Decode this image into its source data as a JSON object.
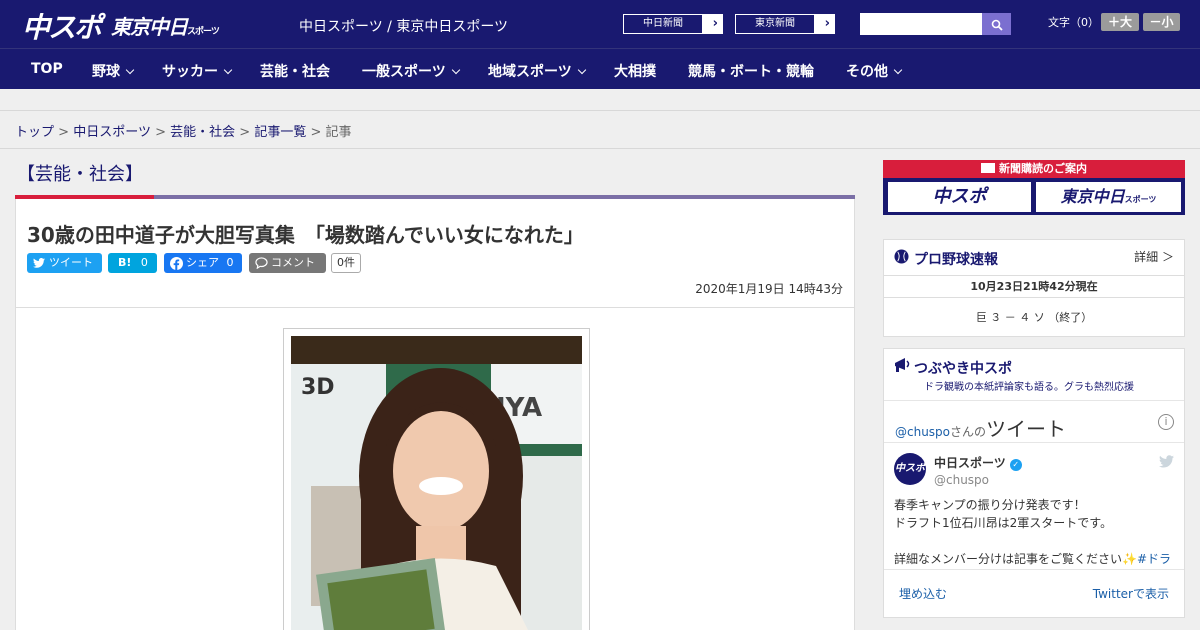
{
  "header": {
    "logo_main": "中スポ",
    "logo_tokyo": "東京中日",
    "logo_tokyo_small": "スポーツ",
    "site_title": "中日スポーツ / 東京中日スポーツ",
    "paper_links": [
      {
        "label": "中日新聞",
        "arrow": "›"
      },
      {
        "label": "東京新聞",
        "arrow": "›"
      }
    ],
    "search_placeholder": "",
    "fontsize_label": "文字（0）",
    "fontsize_up": "＋大",
    "fontsize_down": "－小"
  },
  "nav": {
    "items": [
      {
        "label": "TOP"
      },
      {
        "label": "野球"
      },
      {
        "label": "サッカー"
      },
      {
        "label": "芸能・社会"
      },
      {
        "label": "一般スポーツ"
      },
      {
        "label": "地域スポーツ"
      },
      {
        "label": "大相撲"
      },
      {
        "label": "競馬・ボート・競輪"
      },
      {
        "label": "その他"
      }
    ]
  },
  "breadcrumb": {
    "items": [
      "トップ",
      "中日スポーツ",
      "芸能・社会",
      "記事一覧"
    ],
    "separator": ">",
    "current": "記事"
  },
  "article": {
    "category": "【芸能・社会】",
    "headline": "30歳の田中道子が大胆写真集　「場数踏んでいい女になれた」",
    "share": {
      "tweet_label": "ツイート",
      "hatena_label": "B!",
      "hatena_count": "0",
      "facebook_label": "シェア",
      "facebook_count": "0",
      "comment_label": "コメント",
      "comment_count": "0件"
    },
    "date": "2020年1月19日 14時43分"
  },
  "sidebar": {
    "subscription": {
      "title": "新聞購読のご案内",
      "left": "中スポ",
      "right": "東京中日",
      "right_small": "スポーツ"
    },
    "baseball": {
      "title": "プロ野球速報",
      "detail": "詳細 ＞",
      "updated": "10月23日21時42分現在",
      "score": "巨 ３ － ４ ソ （終了）"
    },
    "twitter": {
      "title": "つぶやき中スポ",
      "subtitle": "ドラ観戦の本紙評論家も語る。グラも熱烈応援",
      "handle": "@chuspo",
      "handle_suffix": "さんの",
      "header_big": "ツイート",
      "account_name": "中日スポーツ",
      "account_user": "@chuspo",
      "avatar_text": "中スポ",
      "tweet_line1": "春季キャンプの振り分け発表です！",
      "tweet_line2": "ドラフト1位石川昂は2軍スタートです。",
      "tweet_line3": "詳細なメンバー分けは記事をご覧ください",
      "tweet_tag": "✨#ドラ",
      "embed": "埋め込む",
      "view_on": "Twitterで表示"
    }
  },
  "colors": {
    "brand_navy": "#191970",
    "accent_red": "#d81e3c",
    "twitter_blue": "#1da1f2",
    "facebook_blue": "#1877f2",
    "hatena_blue": "#00a4de"
  }
}
